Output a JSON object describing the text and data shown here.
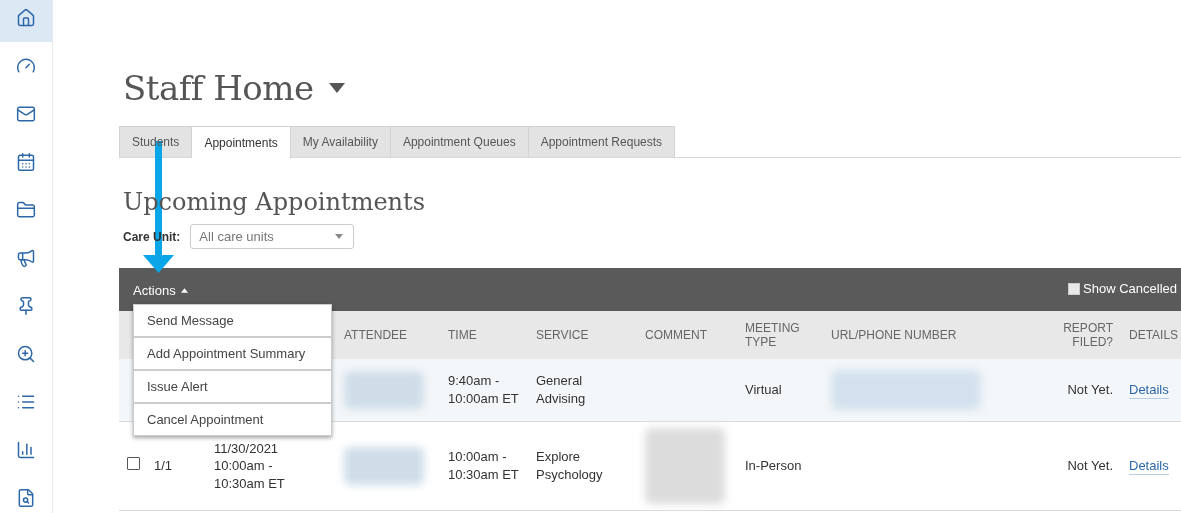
{
  "sidebar": {
    "items": [
      {
        "selected": true
      },
      {
        "selected": false
      },
      {
        "selected": false
      },
      {
        "selected": false
      },
      {
        "selected": false
      },
      {
        "selected": false
      },
      {
        "selected": false
      },
      {
        "selected": false
      },
      {
        "selected": false
      },
      {
        "selected": false
      },
      {
        "selected": false
      }
    ]
  },
  "page_title": "Staff Home",
  "tabs": [
    {
      "label": "Students",
      "selected": false
    },
    {
      "label": "Appointments",
      "selected": true
    },
    {
      "label": "My Availability",
      "selected": false
    },
    {
      "label": "Appointment Queues",
      "selected": false
    },
    {
      "label": "Appointment Requests",
      "selected": false
    }
  ],
  "section_title": "Upcoming Appointments",
  "care_unit": {
    "label": "Care Unit:",
    "value": "All care units"
  },
  "toolbar": {
    "actions_label": "Actions",
    "show_cancelled": {
      "label": "Show Cancelled",
      "checked": false
    }
  },
  "actions_menu": {
    "expanded": true,
    "items": [
      "Send Message",
      "Add Appointment Summary",
      "Issue Alert",
      "Cancel Appointment"
    ]
  },
  "table": {
    "columns": [
      "ATTENDEE",
      "TIME",
      "SERVICE",
      "COMMENT",
      "MEETING TYPE",
      "URL/PHONE NUMBER",
      "REPORT FILED?",
      "DETAILS"
    ],
    "rows": [
      {
        "highlighted": true,
        "attendee_blurred": true,
        "time": "9:40am - 10:00am ET",
        "service": "General Advising",
        "comment_blurred": false,
        "meeting_type": "Virtual",
        "url_blurred": true,
        "report_filed": "Not Yet.",
        "details": "Details"
      },
      {
        "highlighted": false,
        "checked": false,
        "number": "1/1",
        "date": "11/30/2021 10:00am - 10:30am ET",
        "attendee_blurred": true,
        "time": "10:00am - 10:30am ET",
        "service": "Explore Psychology",
        "comment_blurred": true,
        "meeting_type": "In-Person",
        "url_blurred": false,
        "report_filed": "Not Yet.",
        "details": "Details"
      }
    ]
  },
  "annotation": {
    "arrow": true
  }
}
